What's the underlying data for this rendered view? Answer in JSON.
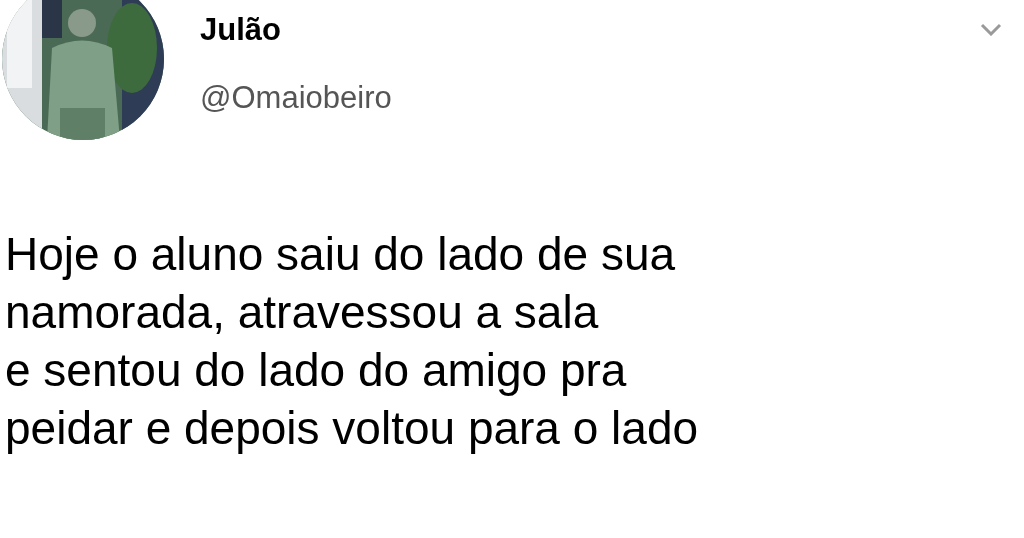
{
  "author": {
    "name": "Julão",
    "handle": "@Omaiobeiro"
  },
  "tweet_lines": [
    "Hoje o aluno saiu do lado de sua",
    "namorada, atravessou a sala",
    "e sentou do lado do amigo pra",
    "peidar e depois voltou para o lado"
  ]
}
